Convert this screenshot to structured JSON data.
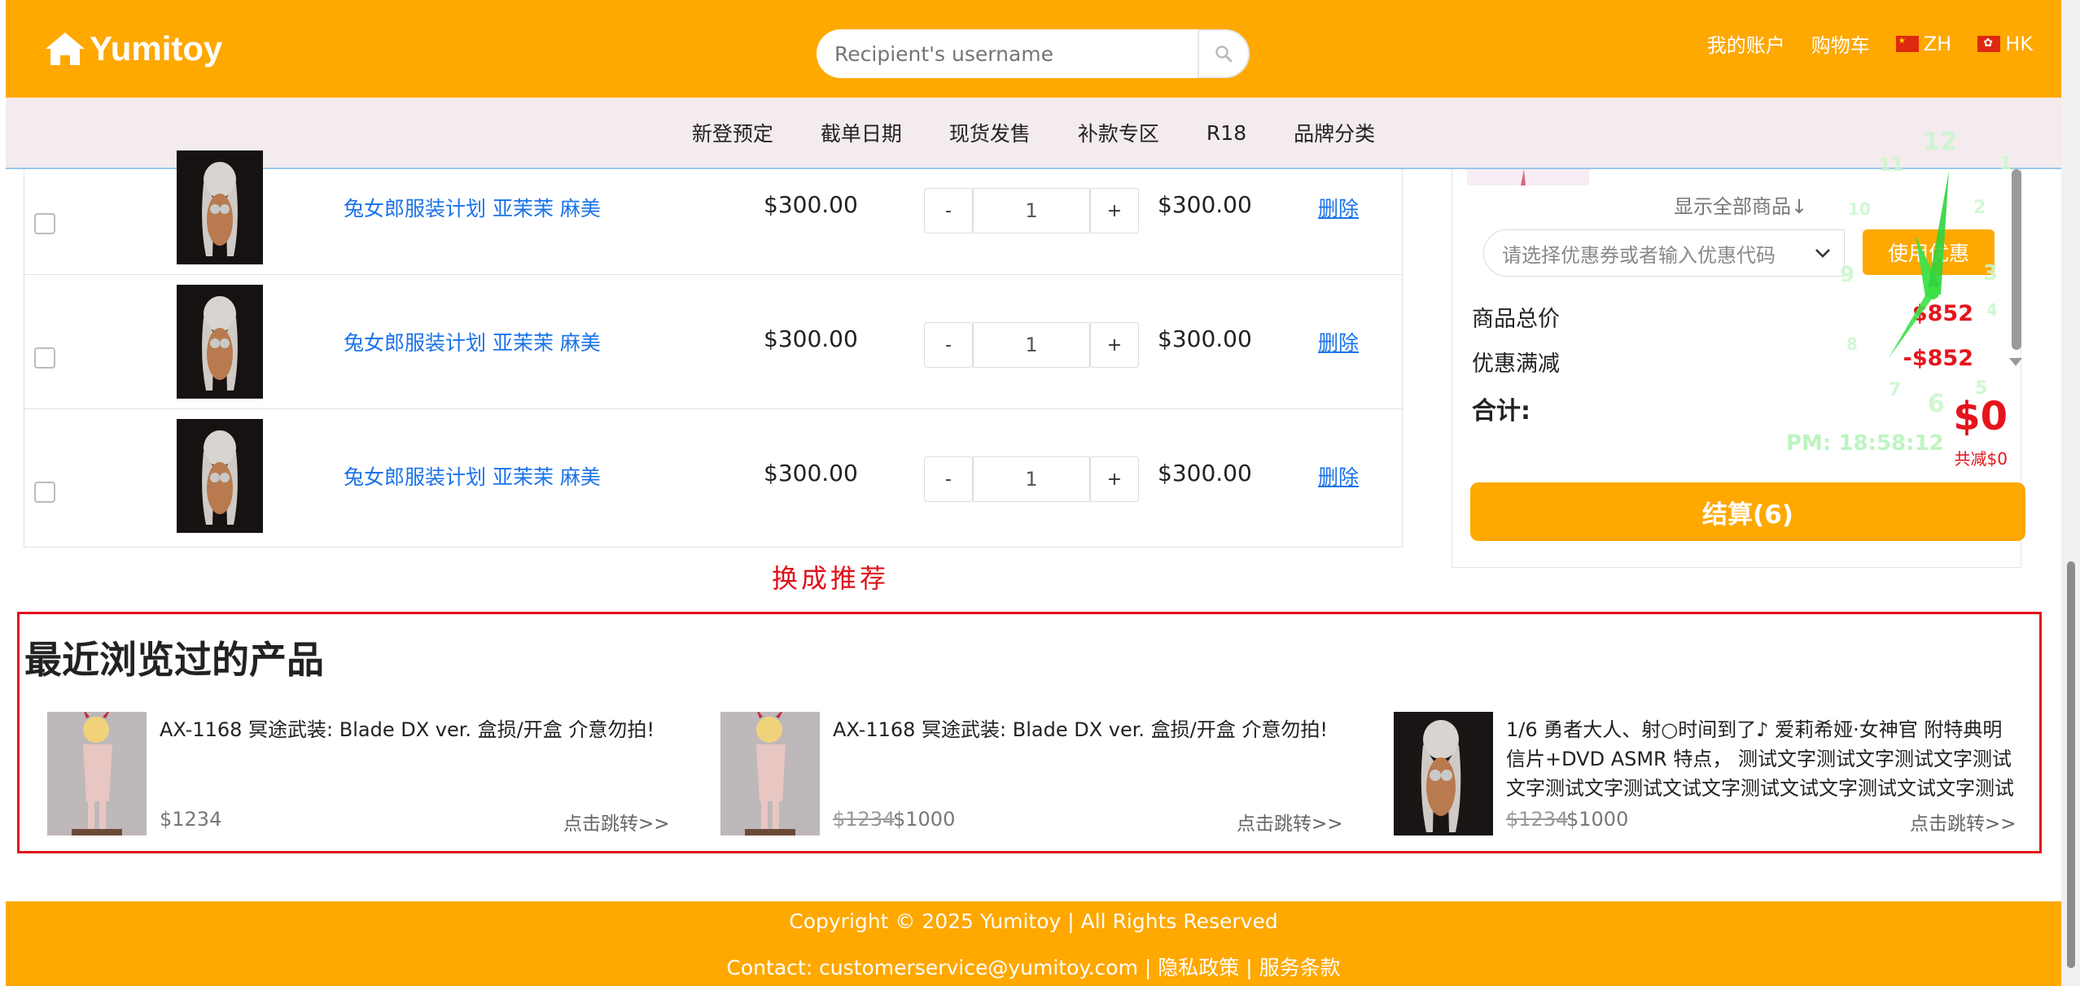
{
  "header": {
    "brand": "Yumitoy",
    "search_placeholder": "Recipient's username",
    "links": {
      "account": "我的账户",
      "cart": "购物车",
      "lang_zh": "ZH",
      "lang_hk": "HK"
    }
  },
  "nav": [
    "新登预定",
    "截单日期",
    "现货发售",
    "补款专区",
    "R18",
    "品牌分类"
  ],
  "cart": {
    "rows": [
      {
        "name": "兔女郎服装计划 亚茉茉 麻美",
        "price": "$300.00",
        "qty": "1",
        "subtotal": "$300.00",
        "delete": "删除"
      },
      {
        "name": "兔女郎服装计划 亚茉茉 麻美",
        "price": "$300.00",
        "qty": "1",
        "subtotal": "$300.00",
        "delete": "删除"
      },
      {
        "name": "兔女郎服装计划 亚茉茉 麻美",
        "price": "$300.00",
        "qty": "1",
        "subtotal": "$300.00",
        "delete": "删除"
      }
    ],
    "qty_minus": "-",
    "qty_plus": "+"
  },
  "annotation": "换成推荐",
  "summary": {
    "show_all": "显示全部商品↓",
    "coupon_placeholder": "请选择优惠券或者输入优惠代码",
    "coupon_button": "使用优惠",
    "goods_total_label": "商品总价",
    "goods_total": "$852",
    "discount_label": "优惠满减",
    "discount": "-$852",
    "total_label": "合计:",
    "total": "$0",
    "total_note": "共减$0",
    "checkout": "结算(6)"
  },
  "clock": {
    "time": "PM: 18:58:12",
    "numerals": [
      "12",
      "1",
      "2",
      "3",
      "4",
      "5",
      "6",
      "7",
      "8",
      "9",
      "10",
      "11"
    ]
  },
  "recent": {
    "title": "最近浏览过的产品",
    "items": [
      {
        "name": "AX-1168 冥途武装: Blade DX ver. 盒损/开盒 介意勿拍!",
        "old_price": "",
        "price": "$1234",
        "link": "点击跳转>>"
      },
      {
        "name": "AX-1168 冥途武装: Blade DX ver. 盒损/开盒 介意勿拍!",
        "old_price": "$1234",
        "price": "$1000",
        "link": "点击跳转>>"
      },
      {
        "name": "1/6 勇者大人、射○时间到了♪ 爱莉希娅·女神官 附特典明信片+DVD ASMR 特点， 测试文字测试文字测试文字测试文字测试文字测试文试文字测试文试文字测试文试文字测试文",
        "old_price": "$1234",
        "price": "$1000",
        "link": "点击跳转>>"
      }
    ]
  },
  "footer": {
    "copyright": "Copyright © 2025 Yumitoy | All Rights Reserved",
    "contact": "Contact: customerservice@yumitoy.com | 隐私政策 | 服务条款"
  },
  "colors": {
    "brand_orange": "#fea800",
    "price_red": "#e5141c",
    "link_blue": "#1a73e8",
    "nav_bg": "#f3ebee",
    "clock_green": "#3ee04a"
  }
}
